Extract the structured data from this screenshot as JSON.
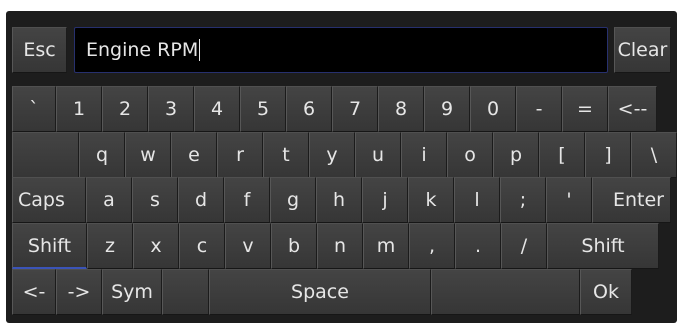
{
  "entry": {
    "value": "Engine RPM"
  },
  "buttons": {
    "esc": "Esc",
    "clear": "Clear"
  },
  "rows": [
    [
      "`",
      "1",
      "2",
      "3",
      "4",
      "5",
      "6",
      "7",
      "8",
      "9",
      "0",
      "-",
      "=",
      "<--"
    ],
    [
      "",
      "q",
      "w",
      "e",
      "r",
      "t",
      "y",
      "u",
      "i",
      "o",
      "p",
      "[",
      "]",
      "\\"
    ],
    [
      "Caps",
      "a",
      "s",
      "d",
      "f",
      "g",
      "h",
      "j",
      "k",
      "l",
      ";",
      "'",
      "Enter"
    ],
    [
      "Shift",
      "z",
      "x",
      "c",
      "v",
      "b",
      "n",
      "m",
      ",",
      ".",
      "/",
      "Shift"
    ],
    [
      "<-",
      "->",
      "Sym",
      "",
      "Space",
      "",
      "Ok"
    ]
  ],
  "colors": {
    "active_shift": "#3b54b8"
  }
}
